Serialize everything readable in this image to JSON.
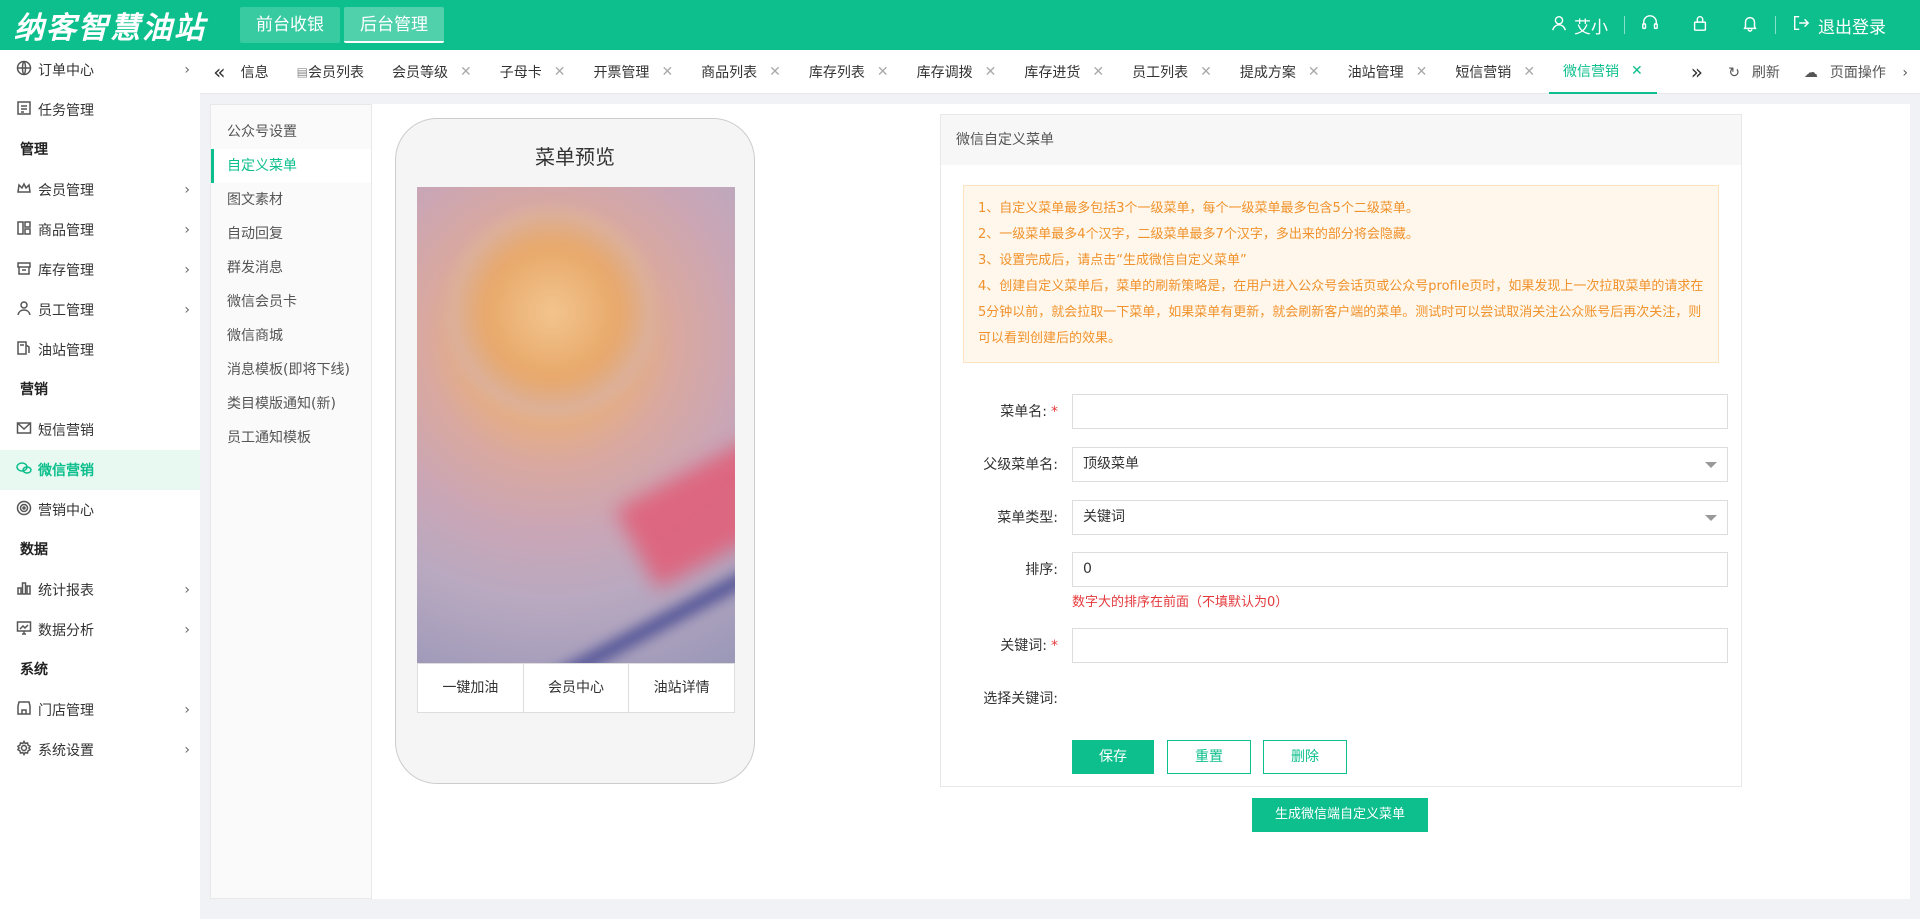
{
  "header": {
    "logo": "纳客智慧油站",
    "nav": [
      {
        "label": "前台收银",
        "active": false
      },
      {
        "label": "后台管理",
        "active": true
      }
    ],
    "user_name": "艾小",
    "logout_label": "退出登录"
  },
  "sidebar": {
    "items": [
      {
        "type": "item",
        "label": "订单中心",
        "icon": "globe-icon",
        "chevron": true
      },
      {
        "type": "item",
        "label": "任务管理",
        "icon": "task-icon",
        "chevron": false
      },
      {
        "type": "group",
        "label": "管理"
      },
      {
        "type": "item",
        "label": "会员管理",
        "icon": "crown-icon",
        "chevron": true
      },
      {
        "type": "item",
        "label": "商品管理",
        "icon": "goods-icon",
        "chevron": true
      },
      {
        "type": "item",
        "label": "库存管理",
        "icon": "box-icon",
        "chevron": true
      },
      {
        "type": "item",
        "label": "员工管理",
        "icon": "user-icon",
        "chevron": true
      },
      {
        "type": "item",
        "label": "油站管理",
        "icon": "pump-icon",
        "chevron": false
      },
      {
        "type": "group",
        "label": "营销"
      },
      {
        "type": "item",
        "label": "短信营销",
        "icon": "mail-icon",
        "chevron": false
      },
      {
        "type": "item",
        "label": "微信营销",
        "icon": "wechat-icon",
        "chevron": false,
        "active": true
      },
      {
        "type": "item",
        "label": "营销中心",
        "icon": "target-icon",
        "chevron": false
      },
      {
        "type": "group",
        "label": "数据"
      },
      {
        "type": "item",
        "label": "统计报表",
        "icon": "bar-chart-icon",
        "chevron": true
      },
      {
        "type": "item",
        "label": "数据分析",
        "icon": "analysis-icon",
        "chevron": true
      },
      {
        "type": "group",
        "label": "系统"
      },
      {
        "type": "item",
        "label": "门店管理",
        "icon": "store-icon",
        "chevron": true
      },
      {
        "type": "item",
        "label": "系统设置",
        "icon": "gear-icon",
        "chevron": true
      }
    ]
  },
  "tabs": {
    "items": [
      {
        "label": "信息",
        "closable": false
      },
      {
        "label": "会员列表",
        "closable": false,
        "has_icon": true
      },
      {
        "label": "会员等级",
        "closable": true
      },
      {
        "label": "子母卡",
        "closable": true
      },
      {
        "label": "开票管理",
        "closable": true
      },
      {
        "label": "商品列表",
        "closable": true
      },
      {
        "label": "库存列表",
        "closable": true
      },
      {
        "label": "库存调拨",
        "closable": true
      },
      {
        "label": "库存进货",
        "closable": true
      },
      {
        "label": "员工列表",
        "closable": true
      },
      {
        "label": "提成方案",
        "closable": true
      },
      {
        "label": "油站管理",
        "closable": true
      },
      {
        "label": "短信营销",
        "closable": true
      },
      {
        "label": "微信营销",
        "closable": true,
        "active": true
      }
    ],
    "refresh_label": "刷新",
    "page_ops_label": "页面操作"
  },
  "subnav": {
    "items": [
      {
        "label": "公众号设置"
      },
      {
        "label": "自定义菜单",
        "active": true
      },
      {
        "label": "图文素材"
      },
      {
        "label": "自动回复"
      },
      {
        "label": "群发消息"
      },
      {
        "label": "微信会员卡"
      },
      {
        "label": "微信商城"
      },
      {
        "label": "消息模板(即将下线)"
      },
      {
        "label": "类目模版通知(新)"
      },
      {
        "label": "员工通知模板"
      }
    ]
  },
  "preview": {
    "title": "菜单预览",
    "menu": [
      "一键加油",
      "会员中心",
      "油站详情"
    ]
  },
  "panel": {
    "title": "微信自定义菜单",
    "notice": [
      "1、自定义菜单最多包括3个一级菜单，每个一级菜单最多包含5个二级菜单。",
      "2、一级菜单最多4个汉字，二级菜单最多7个汉字，多出来的部分将会隐藏。",
      "3、设置完成后，请点击“生成微信自定义菜单”",
      "4、创建自定义菜单后，菜单的刷新策略是，在用户进入公众号会话页或公众号profile页时，如果发现上一次拉取菜单的请求在5分钟以前，就会拉取一下菜单，如果菜单有更新，就会刷新客户端的菜单。测试时可以尝试取消关注公众账号后再次关注，则可以看到创建后的效果。"
    ],
    "form": {
      "menu_name_label": "菜单名:",
      "menu_name_value": "",
      "parent_label": "父级菜单名:",
      "parent_value": "顶级菜单",
      "type_label": "菜单类型:",
      "type_value": "关键词",
      "order_label": "排序:",
      "order_value": "0",
      "order_hint": "数字大的排序在前面（不填默认为0）",
      "keyword_label": "关键词:",
      "keyword_value": "",
      "select_keyword_label": "选择关键词:",
      "required_mark": "*"
    },
    "buttons": {
      "save": "保存",
      "reset": "重置",
      "delete": "删除"
    }
  },
  "generate_button": "生成微信端自定义菜单",
  "colors": {
    "primary": "#0dbf8c",
    "warning_text": "#f0922b",
    "error": "#e4393c"
  }
}
